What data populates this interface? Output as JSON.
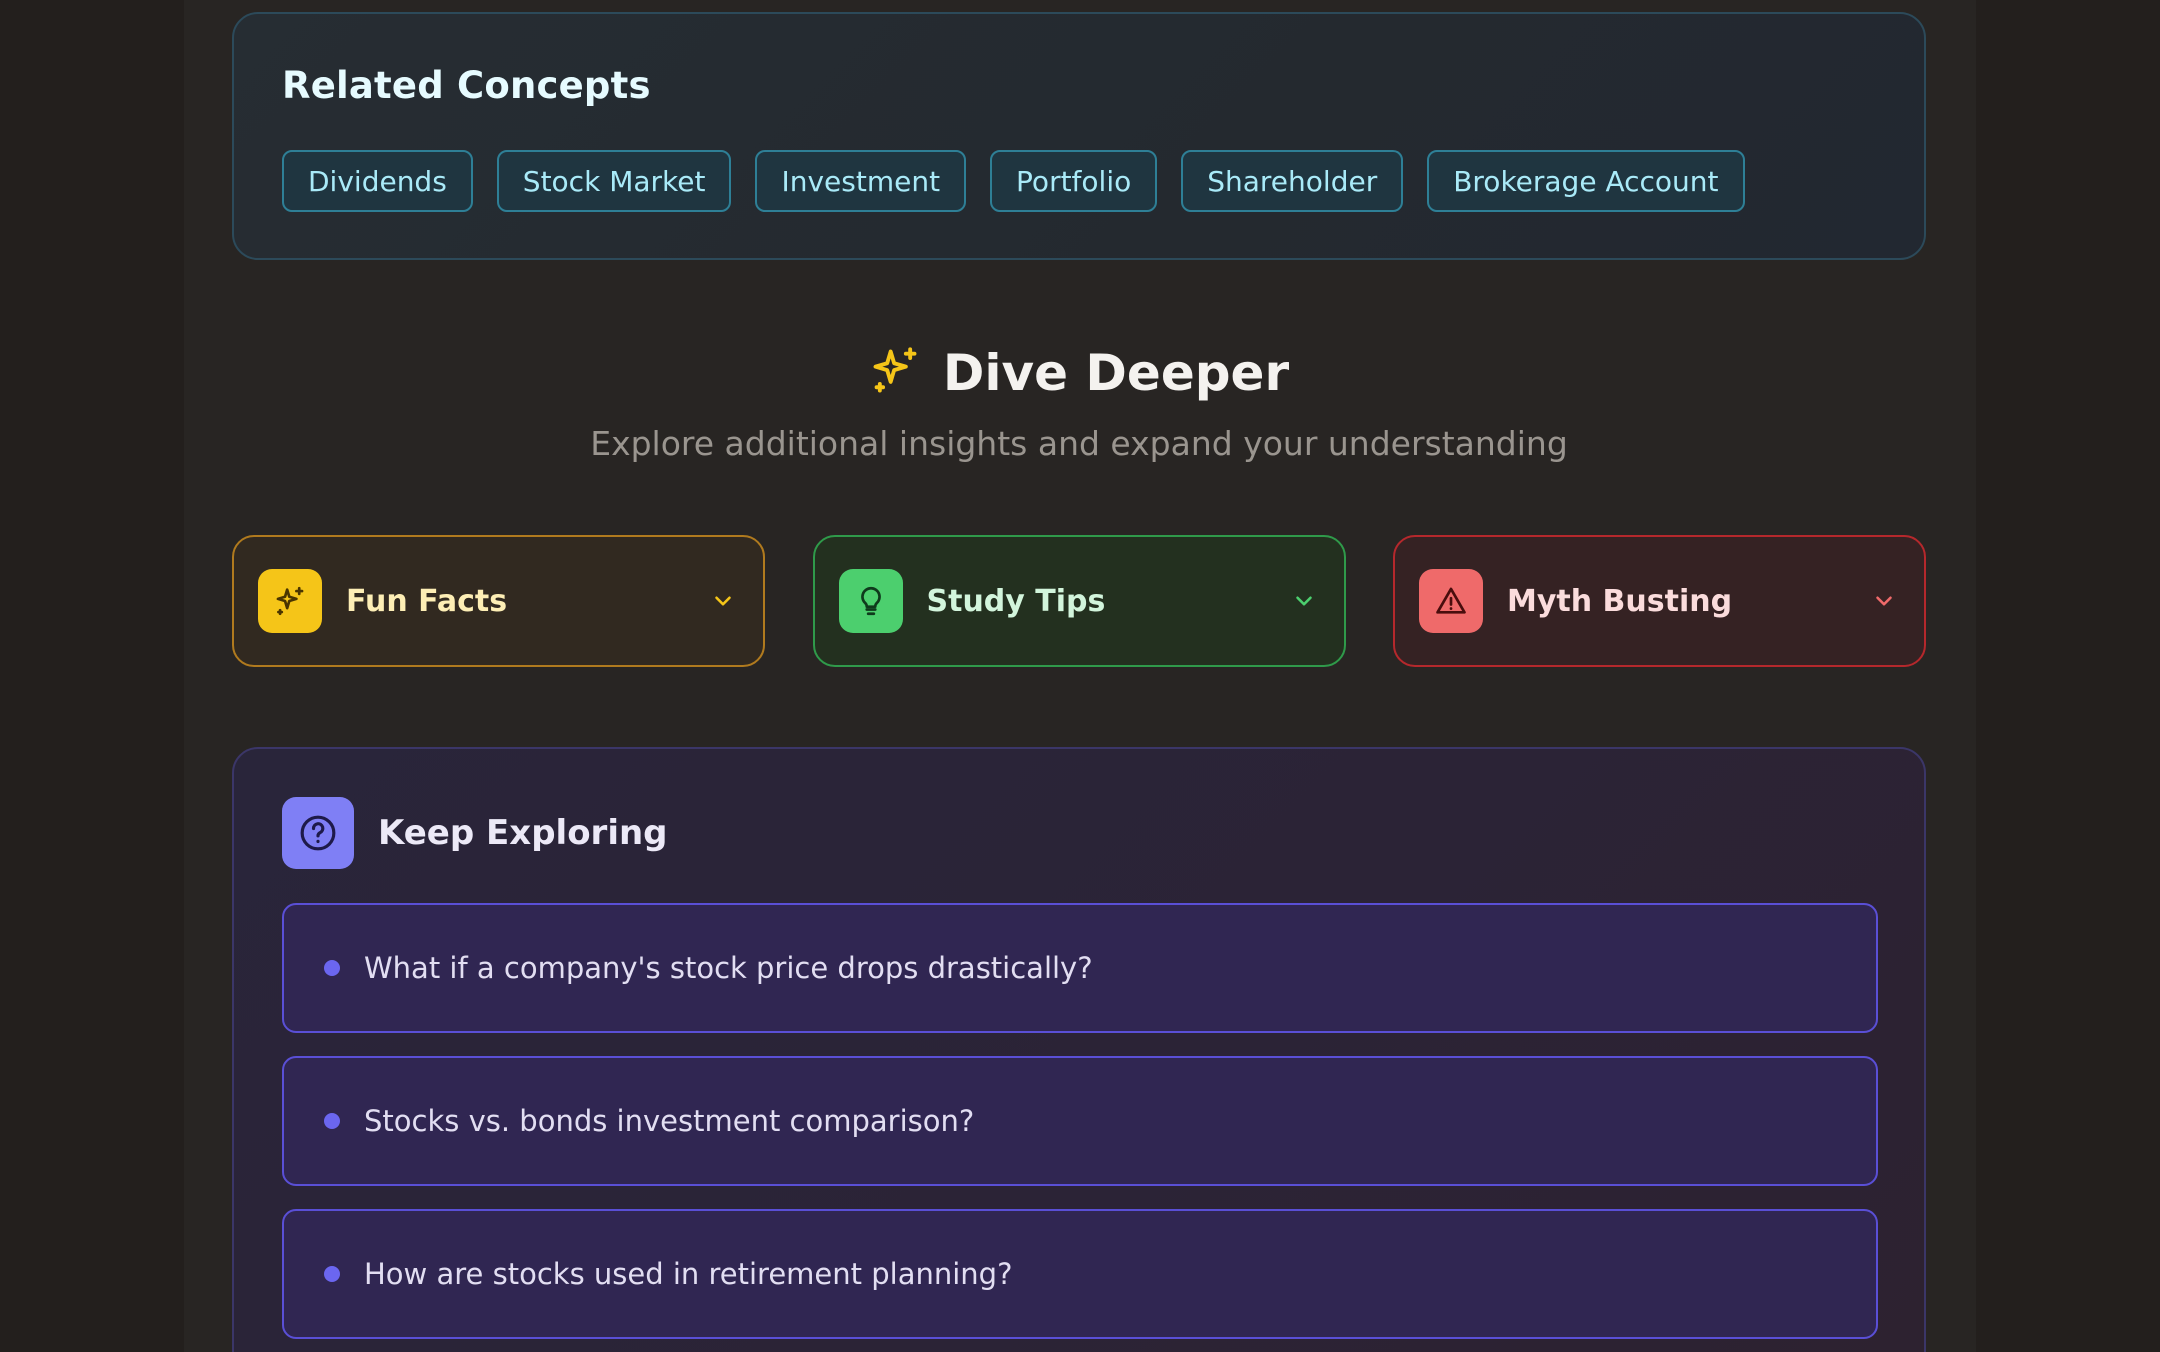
{
  "related": {
    "title": "Related Concepts",
    "chips": [
      "Dividends",
      "Stock Market",
      "Investment",
      "Portfolio",
      "Shareholder",
      "Brokerage Account"
    ]
  },
  "dive": {
    "icon": "sparkle-icon",
    "title": "Dive Deeper",
    "subtitle": "Explore additional insights and expand your understanding"
  },
  "cards": [
    {
      "label": "Fun Facts",
      "icon": "sparkle-icon",
      "accent": "#f5c518"
    },
    {
      "label": "Study Tips",
      "icon": "lightbulb-icon",
      "accent": "#4ccf6e"
    },
    {
      "label": "Myth Busting",
      "icon": "warning-icon",
      "accent": "#ef6a6a"
    }
  ],
  "explore": {
    "icon": "help-circle-icon",
    "title": "Keep Exploring",
    "questions": [
      "What if a company's stock price drops drastically?",
      "Stocks vs. bonds investment comparison?",
      "How are stocks used in retirement planning?"
    ]
  },
  "colors": {
    "chip_text": "#a9eaf8",
    "explore_accent": "#7f7ff5"
  }
}
